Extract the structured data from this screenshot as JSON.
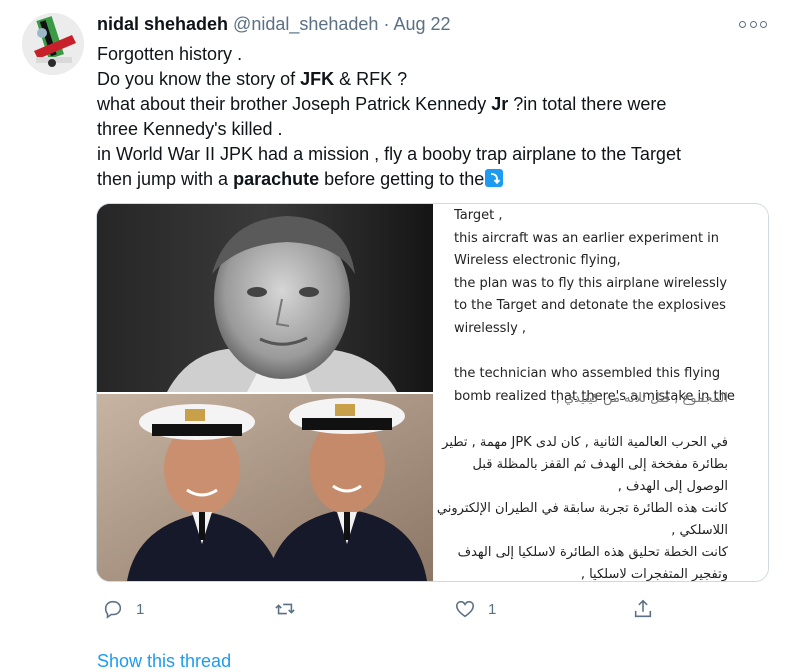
{
  "user": {
    "name": "nidal shehadeh",
    "handle": "@nidal_shehadeh",
    "separator": "·",
    "date": "Aug 22"
  },
  "tweet": {
    "line1": "Forgotten history .",
    "line2_pre": "Do you know the story of ",
    "line2_b1": "JFK",
    "line2_mid": " & RFK ?",
    "line3_pre": "what about their brother Joseph Patrick Kennedy ",
    "line3_b": "Jr",
    "line3_post": " ?in total there were",
    "line4": "three Kennedy's killed .",
    "line5": "in World War II JPK had a mission , fly a booby trap airplane to the Target",
    "line6_pre": "then jump with a ",
    "line6_b": "parachute",
    "line6_post": " before getting to the"
  },
  "media": {
    "english_lines": [
      "Target ,",
      "this aircraft was an earlier experiment in",
      "Wireless electronic flying,",
      "the plan was to fly this airplane wirelessly",
      "to the Target and detonate the explosives",
      "wirelessly ,",
      "",
      "the technician who assembled this flying",
      "bomb realized that there's a mistake in the"
    ],
    "arabic_lines": [
      "المجموع , قتل ثلاثه من كينيدي ,",
      "",
      "في الحرب العالمية الثانية , كان لدى JPK مهمة , تطير",
      "بطائرة مفخخة إلى الهدف ثم القفز بالمظلة قبل",
      "الوصول إلى الهدف ,",
      "كانت هذه الطائرة تجربة سابقة في الطيران الإلكتروني",
      "اللاسلكي ,",
      "كانت الخطة تحليق هذه الطائرة لاسلكيا إلى الهدف",
      "وتفجير المتفجرات لاسلكيا ,"
    ]
  },
  "actions": {
    "reply_count": "1",
    "retweet_count": "",
    "like_count": "1"
  },
  "show_thread": "Show this thread",
  "colors": {
    "accent": "#1d9bf0",
    "secondary_text": "#5b7083",
    "border": "#cfd9de"
  }
}
